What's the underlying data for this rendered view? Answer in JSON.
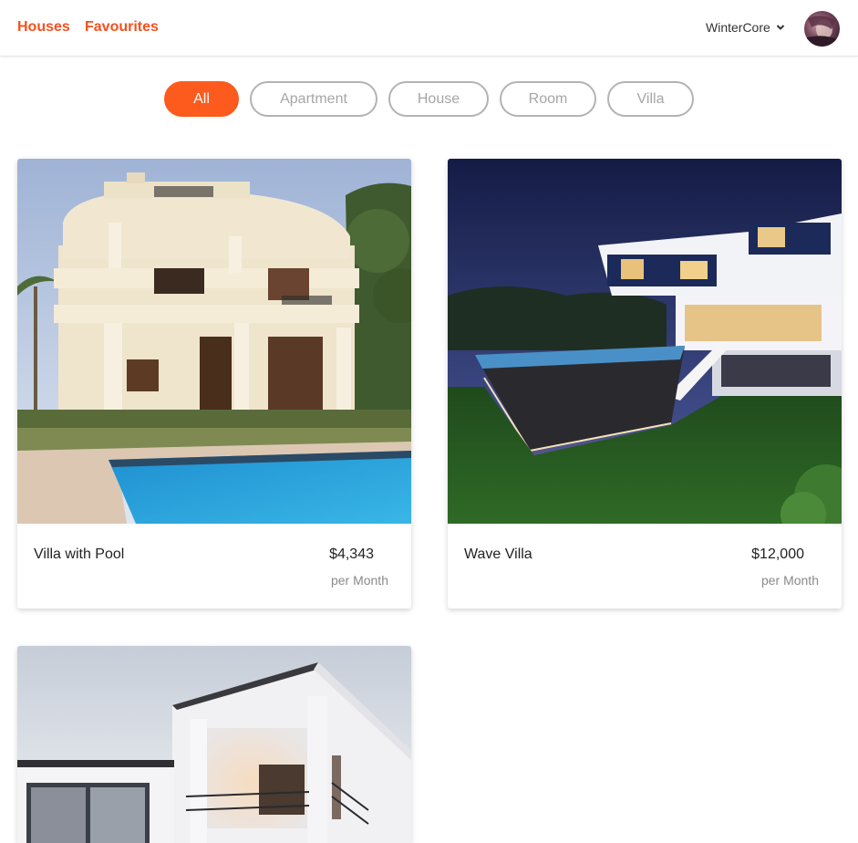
{
  "nav": {
    "houses_label": "Houses",
    "favourites_label": "Favourites",
    "accent_color": "#f4511e"
  },
  "user": {
    "name": "WinterCore",
    "dropdown_icon": "chevron-down-icon"
  },
  "filters": [
    {
      "label": "All",
      "active": true
    },
    {
      "label": "Apartment",
      "active": false
    },
    {
      "label": "House",
      "active": false
    },
    {
      "label": "Room",
      "active": false
    },
    {
      "label": "Villa",
      "active": false
    }
  ],
  "listings": [
    {
      "name": "Villa with Pool",
      "price": "$4,343",
      "period": "per Month"
    },
    {
      "name": "Wave Villa",
      "price": "$12,000",
      "period": "per Month"
    },
    {
      "name": "",
      "price": "",
      "period": ""
    }
  ],
  "colors": {
    "active_filter_bg": "#fd5a1e",
    "inactive_filter_border": "#b3b3b3",
    "inactive_filter_text": "#a6a6a6"
  }
}
